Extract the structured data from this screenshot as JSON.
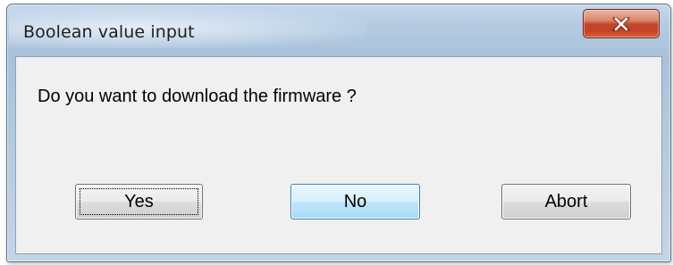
{
  "window": {
    "title": "Boolean value input"
  },
  "icons": {
    "close": "close-icon"
  },
  "dialog": {
    "message": "Do you want to download the firmware ?",
    "buttons": {
      "yes": "Yes",
      "no": "No",
      "abort": "Abort"
    }
  },
  "colors": {
    "close_button": "#c7472b",
    "hover_button_border": "#3c7fb1",
    "client_background": "#f0f0f0",
    "frame": "#b4cbe2"
  }
}
